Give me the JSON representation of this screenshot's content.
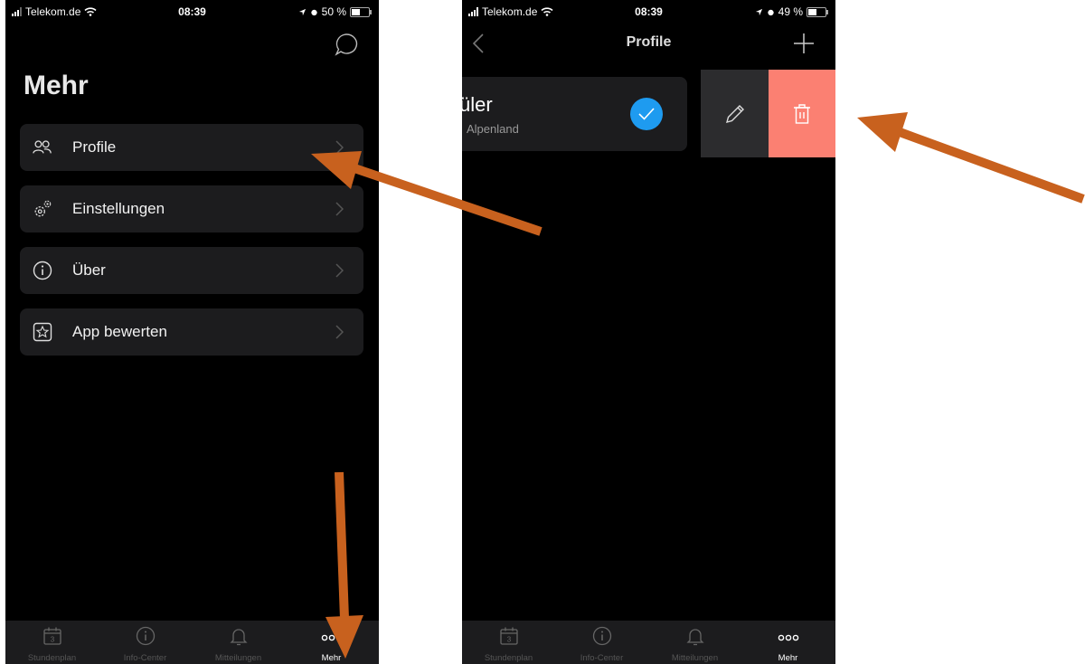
{
  "left_screen": {
    "status": {
      "carrier": "Telekom.de",
      "time": "08:39",
      "battery": "50 %",
      "battery_level": 0.5
    },
    "header": {
      "chat_icon": "chat-bubble-icon"
    },
    "title": "Mehr",
    "menu": [
      {
        "label": "Profile",
        "icon": "users-icon"
      },
      {
        "label": "Einstellungen",
        "icon": "gears-icon"
      },
      {
        "label": "Über",
        "icon": "info-icon"
      },
      {
        "label": "App bewerten",
        "icon": "star-box-icon"
      }
    ]
  },
  "right_screen": {
    "status": {
      "carrier": "Telekom.de",
      "time": "08:39",
      "battery": "49 %",
      "battery_level": 0.49
    },
    "nav": {
      "title": "Profile",
      "back_icon": "chevron-left-icon",
      "add_icon": "plus-icon"
    },
    "profile": {
      "name": "üler",
      "subtitle": "Alpenland"
    },
    "actions": {
      "edit_icon": "pencil-icon",
      "delete_icon": "trash-icon"
    }
  },
  "tabbar": [
    {
      "label": "Stundenplan",
      "icon": "calendar-icon",
      "badge": "3"
    },
    {
      "label": "Info-Center",
      "icon": "info-icon"
    },
    {
      "label": "Mitteilungen",
      "icon": "bell-icon"
    },
    {
      "label": "Mehr",
      "icon": "more-icon"
    }
  ],
  "colors": {
    "accent": "#1e9bf0",
    "delete": "#fb8072",
    "arrow": "#c8611e"
  }
}
